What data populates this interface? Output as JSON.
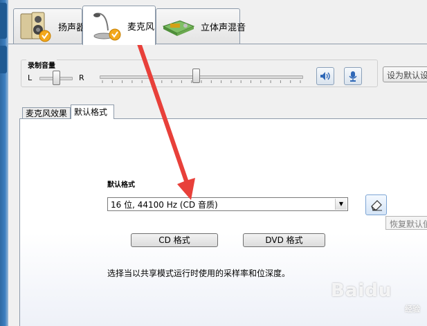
{
  "main_tabs": [
    {
      "label": "扬声器",
      "icon": "speaker-icon"
    },
    {
      "label": "麦克风",
      "icon": "microphone-icon"
    },
    {
      "label": "立体声混音",
      "icon": "stereo-mix-icon"
    }
  ],
  "recording_volume": {
    "title": "录制音量",
    "left_label": "L",
    "right_label": "R",
    "balance": 0.5,
    "level": 0.47,
    "speaker_button_icon": "speaker-volume-icon",
    "mic_button_icon": "microphone-mute-icon",
    "set_default_label": "设为默认设"
  },
  "sub_tabs": [
    {
      "label": "麦克风效果"
    },
    {
      "label": "默认格式"
    }
  ],
  "default_format": {
    "label": "默认格式",
    "selected": "16 位, 44100 Hz (CD 音质)",
    "restore_icon": "eraser-icon",
    "restore_tooltip": "恢复默认值",
    "cd_button": "CD 格式",
    "dvd_button": "DVD 格式",
    "description": "选择当以共享模式运行时使用的采样率和位深度。"
  },
  "annotation_color": "#e8403a",
  "watermark": {
    "brand": "Baidu",
    "sub": "经验"
  }
}
